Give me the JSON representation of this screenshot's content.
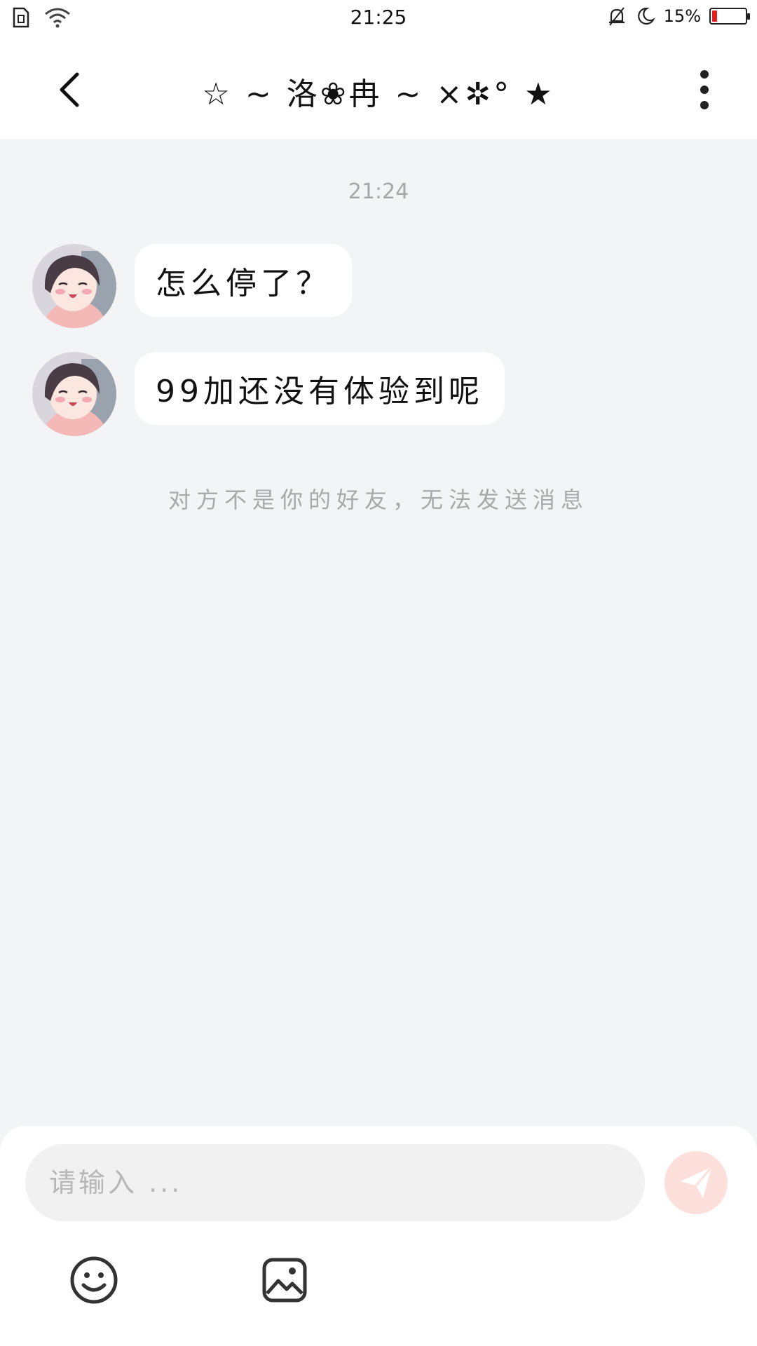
{
  "status_bar": {
    "time": "21:25",
    "battery_percent_label": "15%",
    "battery_level": 0.15,
    "battery_color": "#e12020"
  },
  "header": {
    "title": "☆ ~ 洛❀冉 ~ ×✲° ★",
    "back_icon": "chevron-left-icon",
    "menu_icon": "more-vertical-icon"
  },
  "chat": {
    "timestamp": "21:24",
    "messages": [
      {
        "text": "怎么停了？"
      },
      {
        "text": "99加还没有体验到呢"
      }
    ],
    "notice": "对方不是你的好友，无法发送消息"
  },
  "composer": {
    "placeholder": "请输入 ...",
    "send_color": "#fde0dc",
    "tools": [
      "emoji-icon",
      "image-icon"
    ]
  }
}
